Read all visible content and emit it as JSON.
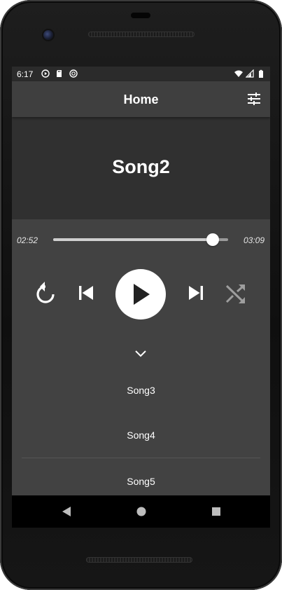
{
  "status_bar": {
    "time": "6:17",
    "left_icons": [
      "play-circle-icon",
      "sd-card-icon",
      "sync-icon"
    ],
    "right_icons": [
      "wifi-icon",
      "cell-signal-icon",
      "battery-icon"
    ]
  },
  "app_bar": {
    "title": "Home",
    "equalizer_icon": "tune-icon"
  },
  "now_playing": {
    "title": "Song2",
    "current_time": "02:52",
    "total_time": "03:09",
    "progress_fraction": 0.91
  },
  "controls": {
    "repeat_icon": "repeat-icon",
    "previous_icon": "skip-previous-icon",
    "play_icon": "play-icon",
    "next_icon": "skip-next-icon",
    "shuffle_icon": "shuffle-icon"
  },
  "collapse_icon": "chevron-down-icon",
  "playlist": {
    "items": [
      "Song3",
      "Song4",
      "Song5"
    ]
  },
  "navigation": {
    "back_icon": "back-triangle-icon",
    "home_icon": "home-circle-icon",
    "recents_icon": "recents-square-icon"
  },
  "colors": {
    "screen_bg": "#424242",
    "header_bg": "#303030",
    "app_bar_bg": "#3f3f3f",
    "accent": "#ffffff",
    "shuffle_disabled": "#9e9e9e"
  }
}
